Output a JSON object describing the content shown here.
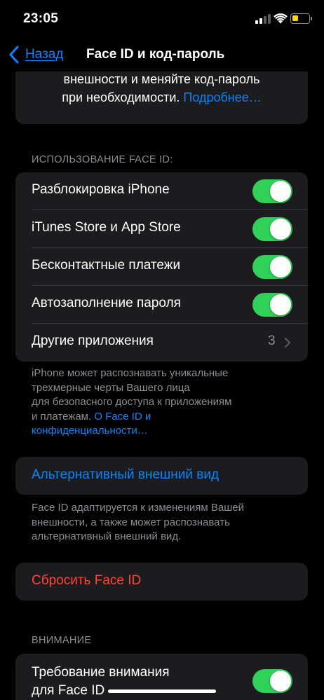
{
  "status_bar": {
    "time": "23:05",
    "battery_level": 0.4,
    "battery_color": "#ffd60a"
  },
  "nav": {
    "back_label": "Назад",
    "title": "Face ID и код-пароль"
  },
  "top_card": {
    "line1": "внешности и меняйте код-пароль",
    "line2_text": "при необходимости. ",
    "line2_link": "Подробнее…"
  },
  "face_id_usage": {
    "header": "ИСПОЛЬЗОВАНИЕ FACE ID:",
    "rows": [
      {
        "label": "Разблокировка iPhone",
        "on": true
      },
      {
        "label": "iTunes Store и App Store",
        "on": true
      },
      {
        "label": "Бесконтактные платежи",
        "on": true
      },
      {
        "label": "Автозаполнение пароля",
        "on": true
      }
    ],
    "other_apps": {
      "label": "Другие приложения",
      "value": "3"
    },
    "footnote_lines": [
      "iPhone может распознавать уникальные",
      "трехмерные черты Вашего лица",
      "для безопасного доступа к приложениям"
    ],
    "footnote_last_text": "и платежам. ",
    "footnote_link_line1": "О Face ID и",
    "footnote_link_line2": "конфиденциальности…"
  },
  "alternate_appearance": {
    "label": "Альтернативный внешний вид",
    "footnote_lines": [
      "Face ID адаптируется к изменениям Вашей",
      "внешности, а также может распознавать",
      "альтернативный внешний вид."
    ]
  },
  "reset": {
    "label": "Сбросить Face ID"
  },
  "attention": {
    "header": "ВНИМАНИЕ",
    "row_line1": "Требование внимания",
    "row_line2": "для Face ID",
    "on": true
  },
  "colors": {
    "accent": "#0a84ff",
    "toggle_on": "#30d158",
    "destructive": "#ff453a",
    "group_bg": "#1c1c1e",
    "secondary_text": "#8d8d93"
  }
}
